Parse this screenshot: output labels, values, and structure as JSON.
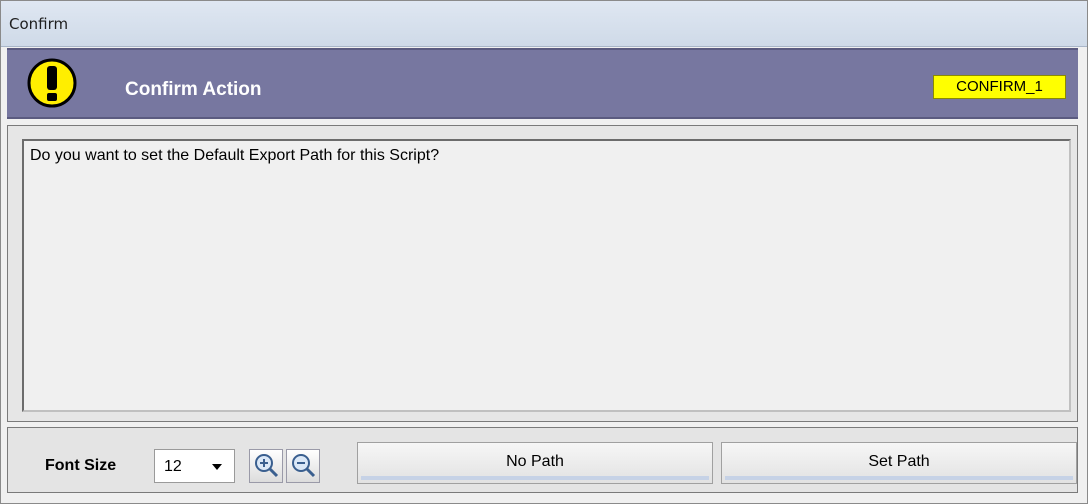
{
  "window": {
    "title": "Confirm"
  },
  "banner": {
    "heading": "Confirm Action",
    "code": "CONFIRM_1",
    "icon": "warning-icon"
  },
  "message": {
    "text": "Do you want to set the Default Export Path for this Script?"
  },
  "footer": {
    "font_size_label": "Font Size",
    "font_size_value": "12",
    "zoom_in_icon": "zoom-in-icon",
    "zoom_out_icon": "zoom-out-icon",
    "no_path_label": "No Path",
    "set_path_label": "Set Path"
  }
}
